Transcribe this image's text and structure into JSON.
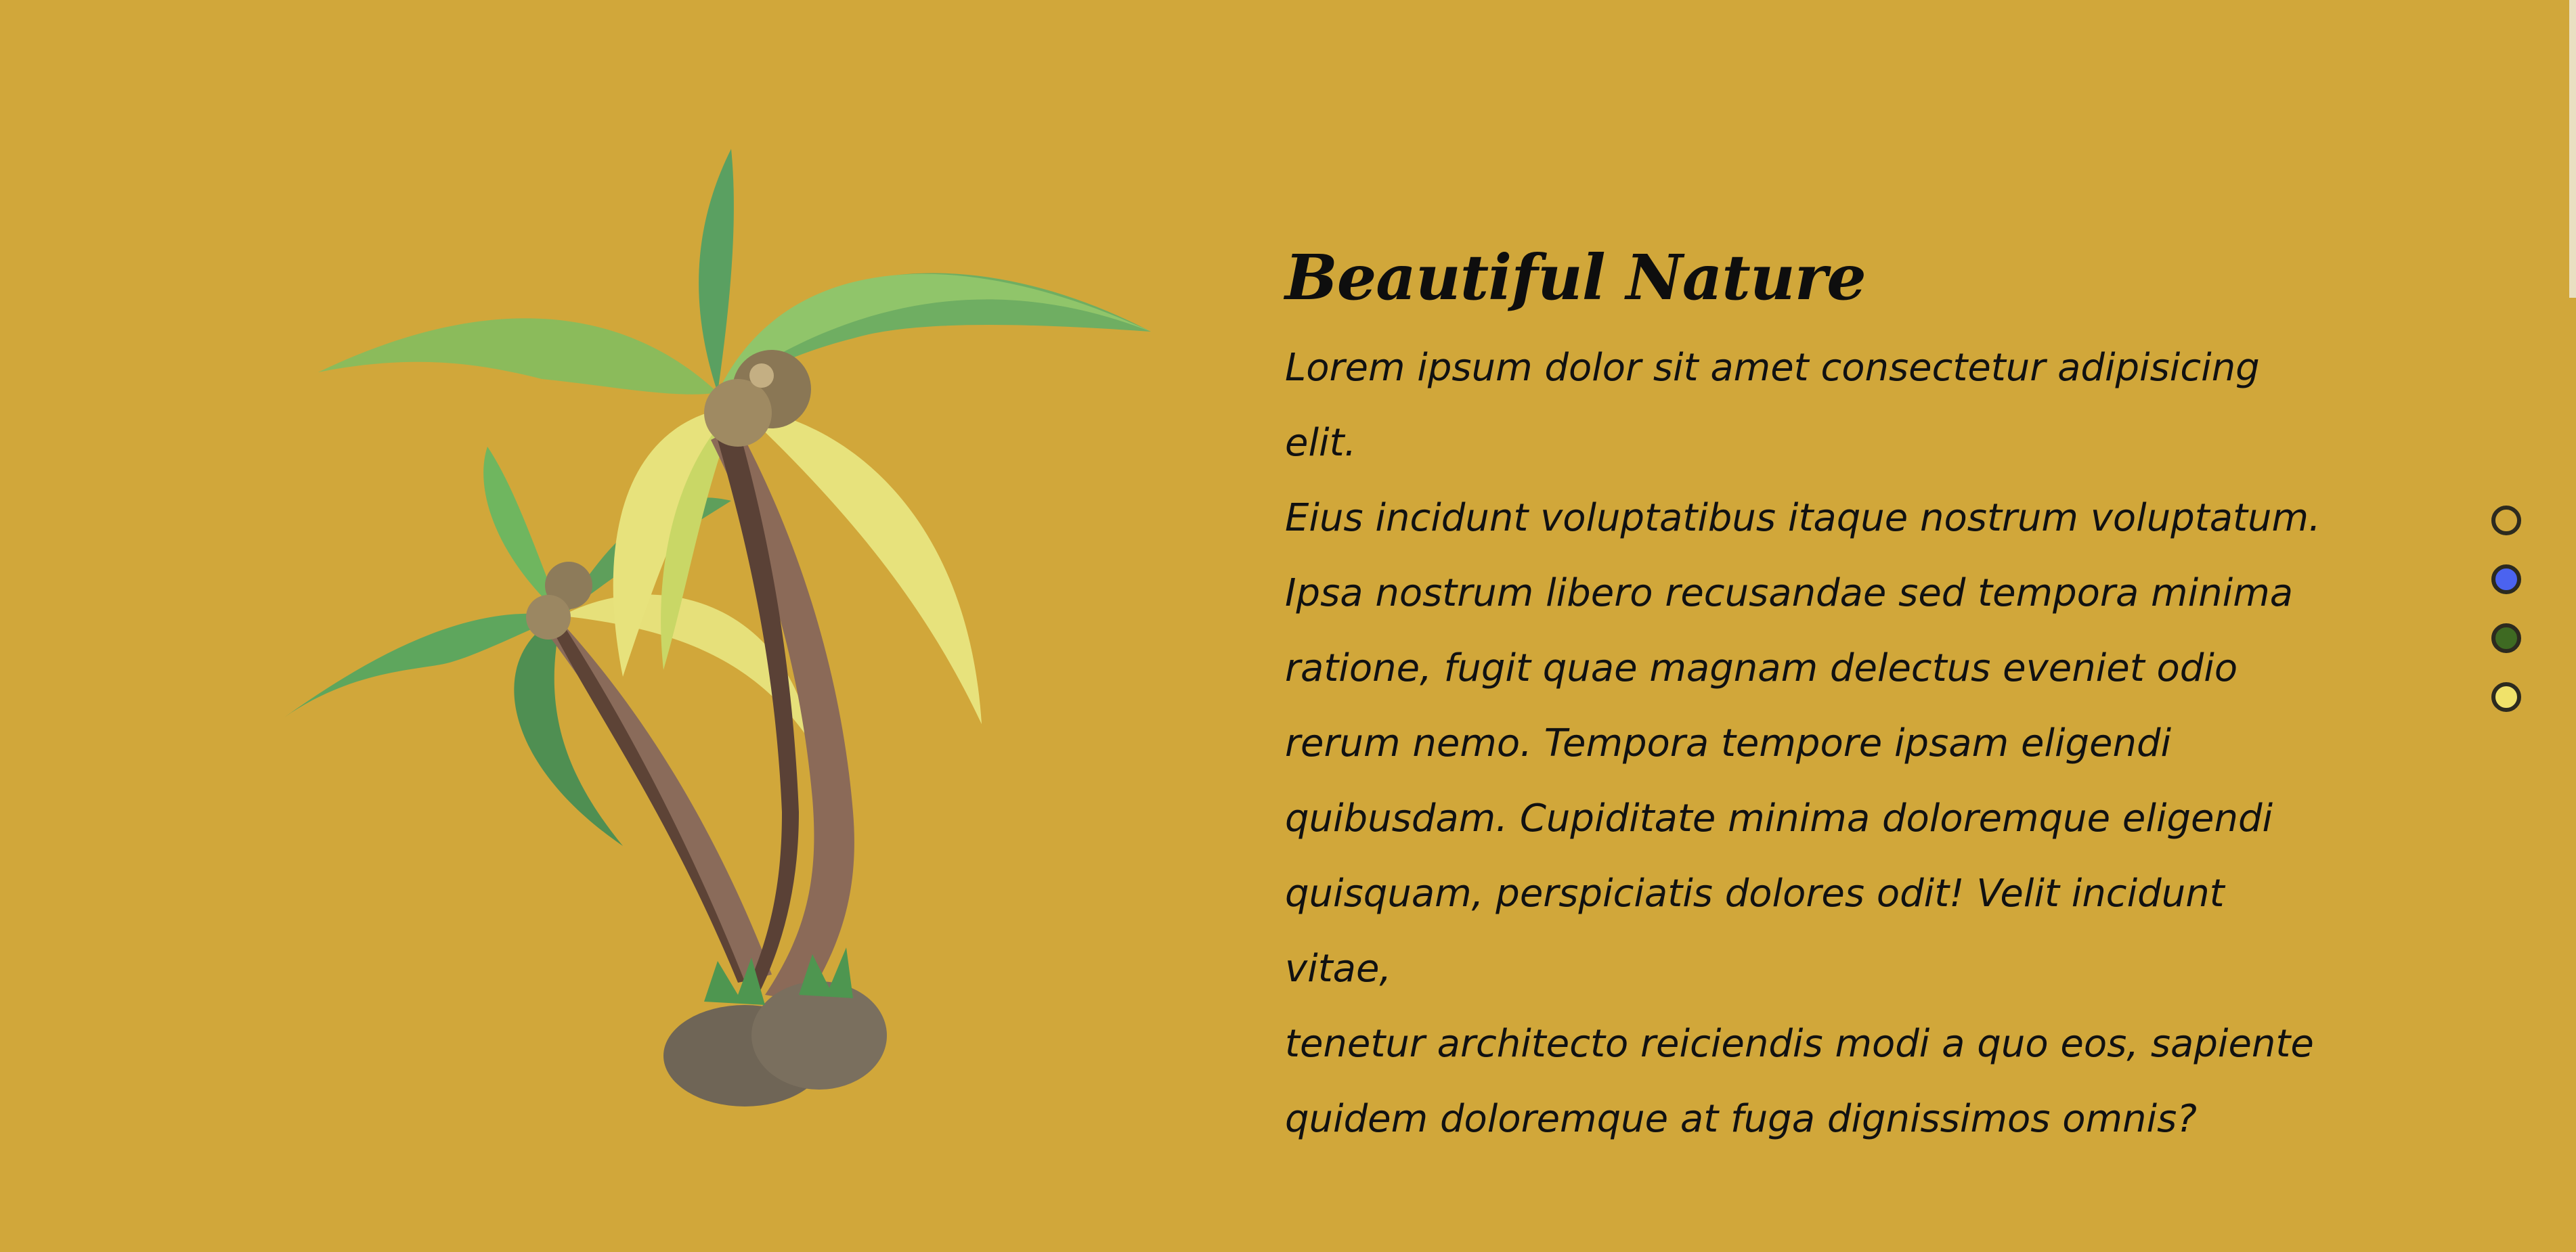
{
  "content": {
    "title": "Beautiful Nature",
    "paragraph_lines": [
      "Lorem ipsum dolor sit amet consectetur adipisicing elit.",
      "Eius incidunt voluptatibus itaque nostrum voluptatum.",
      "Ipsa nostrum libero recusandae sed tempora minima",
      "ratione, fugit quae magnam delectus eveniet odio",
      "rerum nemo. Tempora tempore ipsam eligendi",
      "quibusdam. Cupiditate minima doloremque eligendi",
      "quisquam, perspiciatis dolores odit! Velit incidunt vitae,",
      "tenetur architecto reiciendis modi a quo eos, sapiente",
      "quidem doloremque at fuga dignissimos omnis?"
    ]
  },
  "theme": {
    "background": "#d1a73a",
    "dot_colors": [
      "#d1a73a",
      "#4b63f0",
      "#3e6a22",
      "#f0e26a"
    ]
  },
  "illustration": {
    "icon": "palm-tree-icon"
  }
}
